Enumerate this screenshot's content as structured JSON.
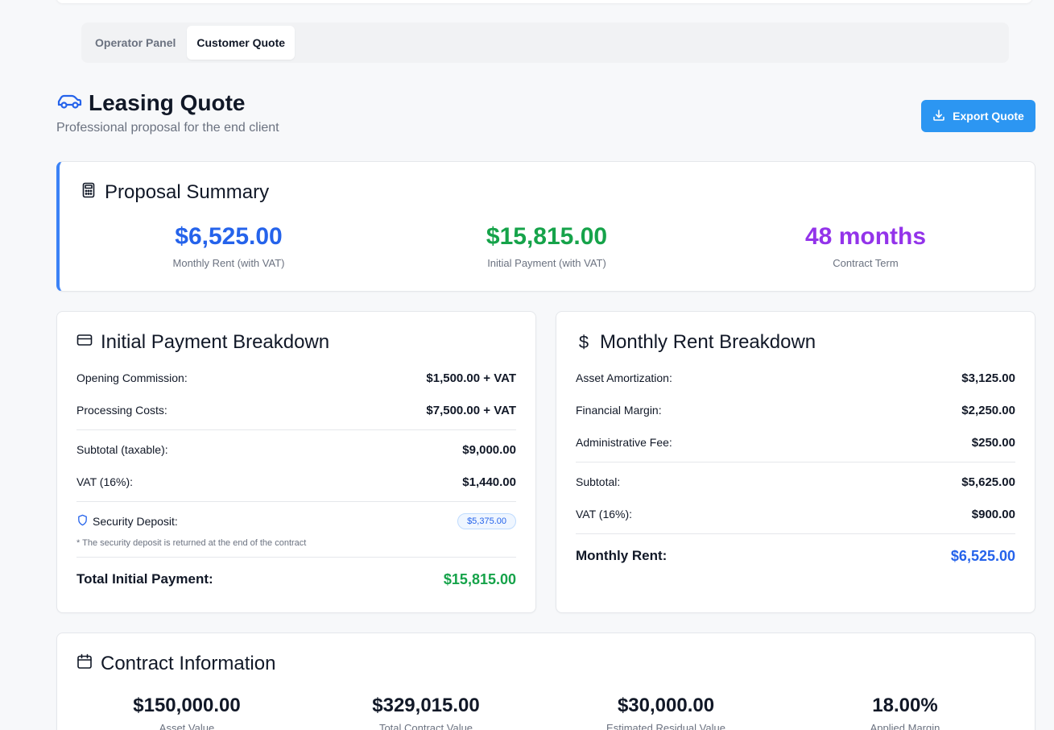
{
  "tabs": [
    "Operator Panel",
    "Customer Quote"
  ],
  "header": {
    "title": "Leasing Quote",
    "subtitle": "Professional proposal for the end client",
    "export_label": "Export Quote"
  },
  "summary": {
    "title": "Proposal Summary",
    "stats": [
      {
        "value": "$6,525.00",
        "label": "Monthly Rent (with VAT)",
        "color": "#2563eb"
      },
      {
        "value": "$15,815.00",
        "label": "Initial Payment (with VAT)",
        "color": "#16a34a"
      },
      {
        "value": "48 months",
        "label": "Contract Term",
        "color": "#9333ea"
      }
    ]
  },
  "initial": {
    "title": "Initial Payment Breakdown",
    "opening_commission": {
      "label": "Opening Commission:",
      "value": "$1,500.00 + VAT"
    },
    "processing_costs": {
      "label": "Processing Costs:",
      "value": "$7,500.00 + VAT"
    },
    "subtotal": {
      "label": "Subtotal (taxable):",
      "value": "$9,000.00"
    },
    "vat": {
      "label": "VAT (16%):",
      "value": "$1,440.00"
    },
    "deposit": {
      "label": "Security Deposit:",
      "value": "$5,375.00"
    },
    "note": "* The security deposit is returned at the end of the contract",
    "total": {
      "label": "Total Initial Payment:",
      "value": "$15,815.00"
    }
  },
  "monthly": {
    "title": "Monthly Rent Breakdown",
    "amortization": {
      "label": "Asset Amortization:",
      "value": "$3,125.00"
    },
    "margin": {
      "label": "Financial Margin:",
      "value": "$2,250.00"
    },
    "admin_fee": {
      "label": "Administrative Fee:",
      "value": "$250.00"
    },
    "subtotal": {
      "label": "Subtotal:",
      "value": "$5,625.00"
    },
    "vat": {
      "label": "VAT (16%):",
      "value": "$900.00"
    },
    "total": {
      "label": "Monthly Rent:",
      "value": "$6,525.00"
    }
  },
  "contract": {
    "title": "Contract Information",
    "stats": [
      {
        "value": "$150,000.00",
        "label": "Asset Value"
      },
      {
        "value": "$329,015.00",
        "label": "Total Contract Value"
      },
      {
        "value": "$30,000.00",
        "label": "Estimated Residual Value"
      },
      {
        "value": "18.00%",
        "label": "Applied Margin"
      }
    ]
  },
  "colors": {
    "accent": "#3b82f6",
    "button": "#2c96f2",
    "green": "#16a34a",
    "purple": "#9333ea",
    "blue": "#2563eb"
  }
}
